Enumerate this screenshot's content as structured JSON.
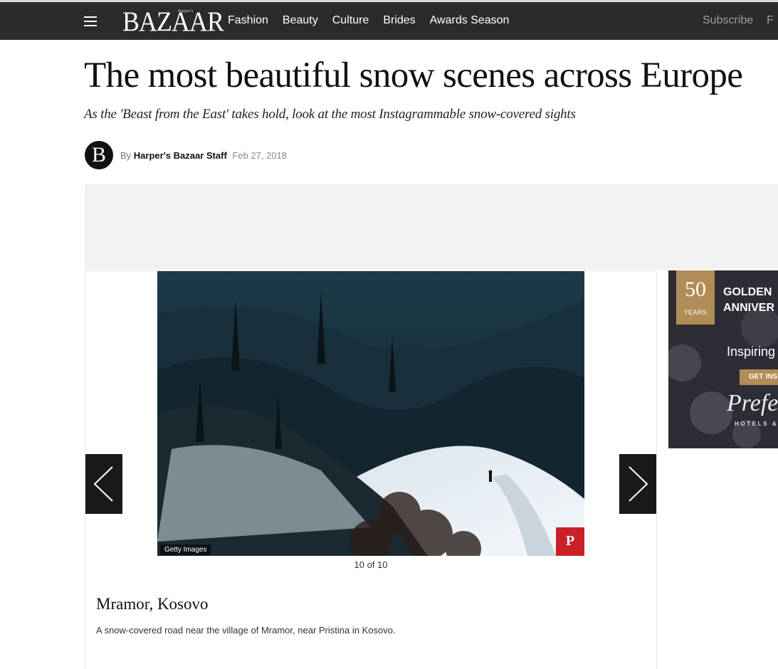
{
  "nav": {
    "logo": "BAZAAR",
    "logo_small": "Harper's",
    "items": [
      {
        "label": "Fashion"
      },
      {
        "label": "Beauty"
      },
      {
        "label": "Culture"
      },
      {
        "label": "Brides"
      },
      {
        "label": "Awards Season"
      }
    ],
    "subscribe": "Subscribe",
    "right_extra": "F"
  },
  "article": {
    "headline": "The most beautiful snow scenes across Europe",
    "dek": "As the 'Beast from the East' takes hold, look at the most Instagrammable snow-covered sights",
    "avatar_letter": "B",
    "by": "By",
    "author": "Harper's Bazaar Staff",
    "date": "Feb 27, 2018"
  },
  "gallery": {
    "photo_credit": "Getty Images",
    "counter": "10 of 10",
    "slide_title": "Mramor, Kosovo",
    "slide_caption": "A snow-covered road near the village of Mramor, near Pristina in Kosovo.",
    "pin_glyph": "P"
  },
  "side_ad": {
    "badge_number": "50",
    "badge_label": "YEARS",
    "heading_line1": "GOLDEN",
    "heading_line2": "ANNIVER",
    "tagline": "Inspiring",
    "cta": "GET INS",
    "script": "Prefe",
    "brand": "HOTELS &"
  },
  "colors": {
    "nav_bg": "#2b2b2b",
    "pinterest_red": "#cb2027",
    "ad_gold": "#b08d57",
    "arrow_bg": "#1a1a1a"
  }
}
